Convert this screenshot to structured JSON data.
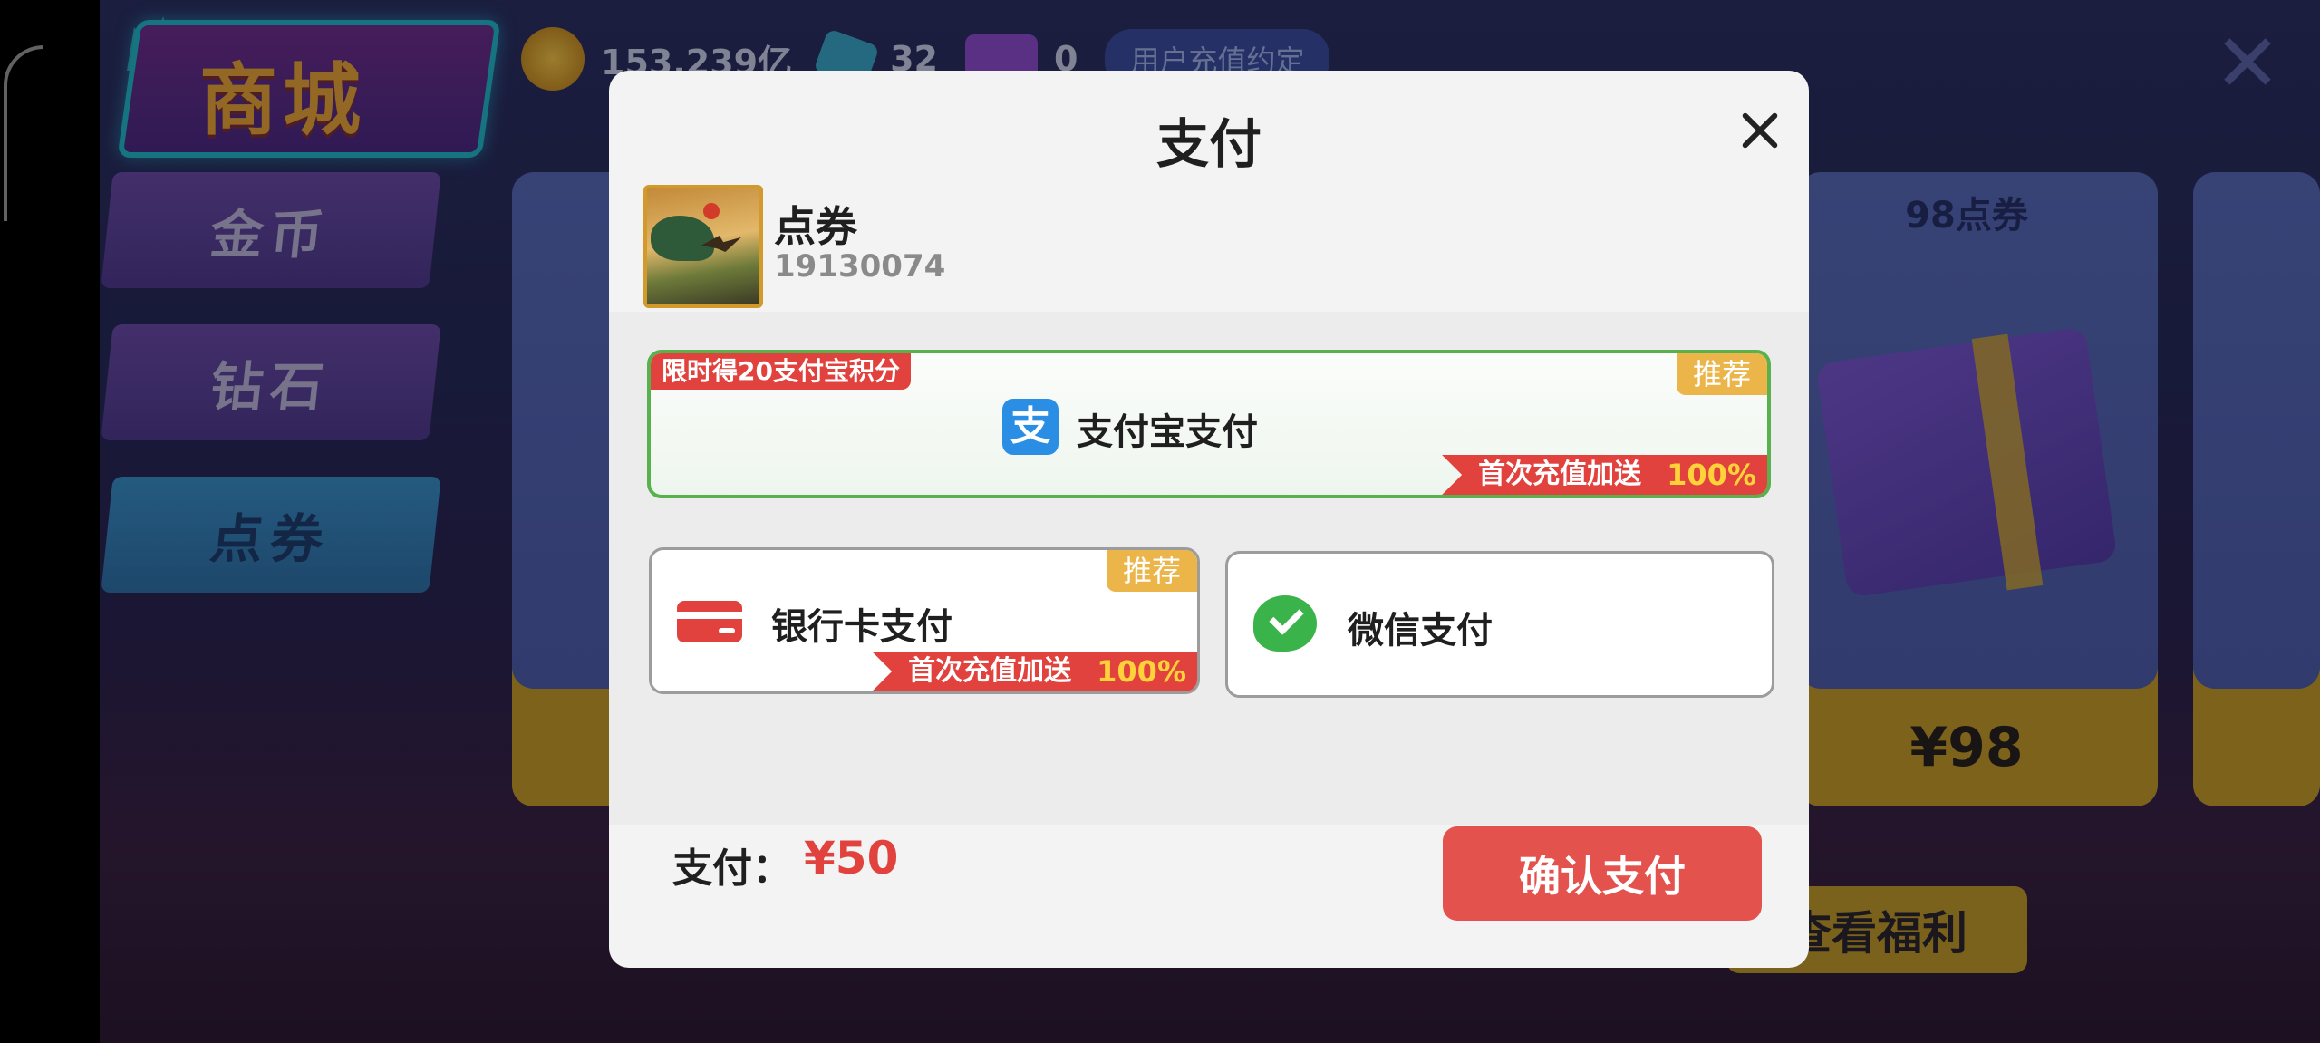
{
  "background": {
    "shop_title": "商城",
    "side_tabs": [
      {
        "label": "金币"
      },
      {
        "label": "钻石"
      },
      {
        "label": "点券"
      }
    ],
    "resources": {
      "gold": "153.239亿",
      "diamonds": "32",
      "tickets": "0",
      "agreement": "用户充值约定"
    },
    "card_98": {
      "title": "98点券",
      "price": "¥98"
    },
    "view_benefits": "查看福利"
  },
  "modal": {
    "title": "支付",
    "product": {
      "name": "点券",
      "id": "19130074"
    },
    "options": {
      "alipay": {
        "promo": "限时得20支付宝积分",
        "badge": "推荐",
        "label": "支付宝支付",
        "icon_glyph": "支",
        "bonus_text": "首次充值加送",
        "bonus_pct": "100%"
      },
      "bank": {
        "badge": "推荐",
        "label": "银行卡支付",
        "bonus_text": "首次充值加送",
        "bonus_pct": "100%"
      },
      "wechat": {
        "label": "微信支付"
      }
    },
    "pay_label": "支付：",
    "pay_amount": "¥50",
    "confirm": "确认支付"
  },
  "icons": [
    "close-icon",
    "alipay-icon",
    "bank-card-icon",
    "wechat-pay-icon",
    "gold-coin-icon",
    "diamond-icon",
    "ticket-icon"
  ],
  "colors": {
    "accent_red": "#e4524d",
    "alipay_border": "#58b14d",
    "badge_gold": "#ebb54a",
    "alipay_blue": "#2a8fe4",
    "wechat_green": "#3ab34a"
  }
}
